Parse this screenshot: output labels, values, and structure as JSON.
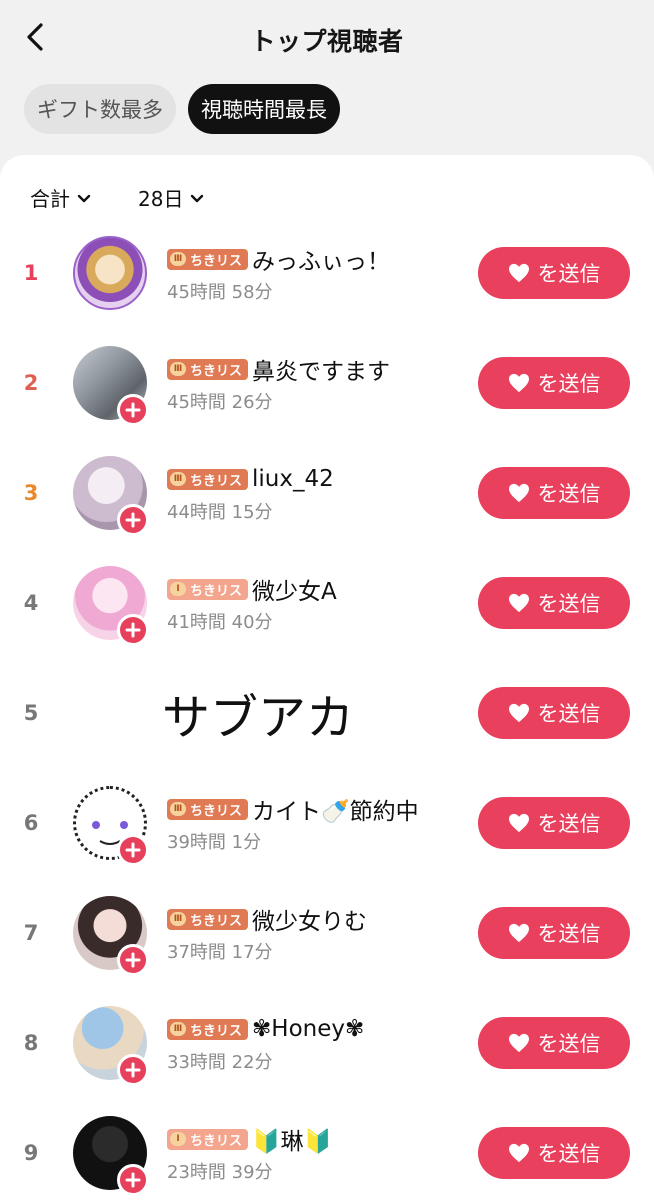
{
  "header": {
    "title": "トップ視聴者"
  },
  "tabs": [
    {
      "label": "ギフト数最多",
      "active": false
    },
    {
      "label": "視聴時間最長",
      "active": true
    }
  ],
  "filters": {
    "scope": "合計",
    "period": "28日"
  },
  "send_label": "を送信",
  "rows": [
    {
      "rank": "1",
      "badge": "ちきリス",
      "name": "みっふぃっ！",
      "time": "45時間 58分"
    },
    {
      "rank": "2",
      "badge": "ちきリス",
      "name": "鼻炎ですます",
      "time": "45時間 26分"
    },
    {
      "rank": "3",
      "badge": "ちきリス",
      "name": "liux_42",
      "time": "44時間 15分"
    },
    {
      "rank": "4",
      "badge": "ちきリス",
      "name": "微少女A",
      "time": "41時間 40分"
    },
    {
      "rank": "5",
      "name": "サブアカ"
    },
    {
      "rank": "6",
      "badge": "ちきリス",
      "name": "カイト🍼節約中",
      "time": "39時間 1分"
    },
    {
      "rank": "7",
      "badge": "ちきリス",
      "name": "微少女りむ",
      "time": "37時間 17分"
    },
    {
      "rank": "8",
      "badge": "ちきリス",
      "name": "✾Honey✾",
      "time": "33時間 22分"
    },
    {
      "rank": "9",
      "badge": "ちきリス",
      "name": "🔰琳🔰",
      "time": "23時間 39分"
    }
  ],
  "colors": {
    "accent": "#e8405d",
    "rank1": "#e6405c",
    "rank2": "#e06050",
    "rank3": "#e88a2c",
    "rank_other": "#777777"
  }
}
